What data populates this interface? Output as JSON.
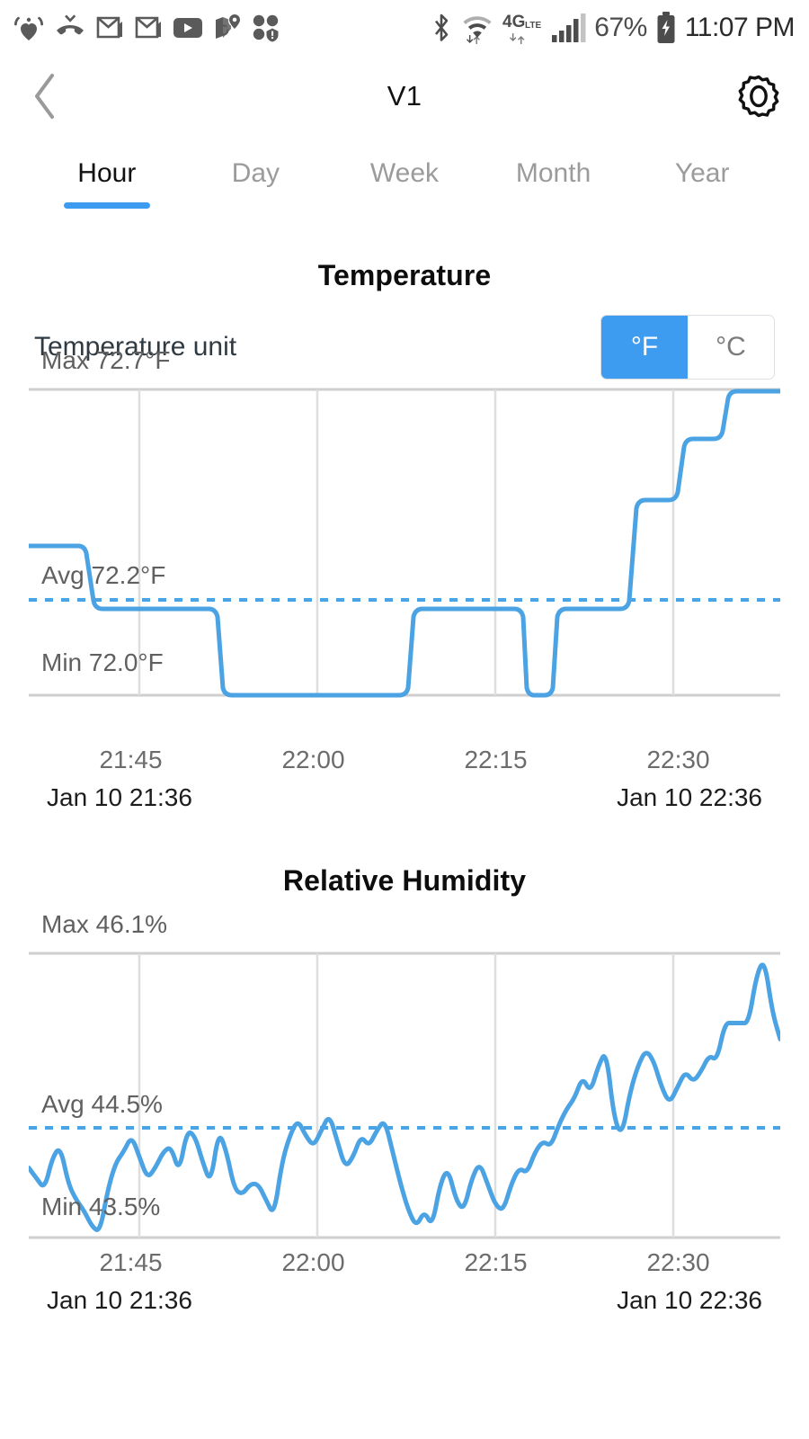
{
  "status_bar": {
    "left_icons": [
      "iheartradio-icon",
      "missed-call-icon",
      "gmail-icon",
      "gmail-icon",
      "youtube-icon",
      "google-maps-icon",
      "app-grid-alert-icon"
    ],
    "right_icons": [
      "bluetooth-icon",
      "wifi-icon",
      "4g-lte-icon",
      "signal-bars-icon",
      "battery-charging-icon"
    ],
    "battery_percent": "67%",
    "clock": "11:07 PM"
  },
  "header": {
    "back_label": "‹",
    "title": "V1",
    "settings_icon": "gear-icon"
  },
  "tabs": [
    {
      "label": "Hour",
      "active": true
    },
    {
      "label": "Day",
      "active": false
    },
    {
      "label": "Week",
      "active": false
    },
    {
      "label": "Month",
      "active": false
    },
    {
      "label": "Year",
      "active": false
    }
  ],
  "temperature": {
    "title": "Temperature",
    "unit_label": "Temperature unit",
    "unit_options": [
      "°F",
      "°C"
    ],
    "unit_selected": "°F",
    "max_label": "Max 72.7°F",
    "avg_label": "Avg 72.2°F",
    "min_label": "Min 72.0°F",
    "x_ticks": [
      "21:45",
      "22:00",
      "22:15",
      "22:30"
    ],
    "range_start": "Jan 10 21:36",
    "range_end": "Jan 10 22:36"
  },
  "humidity": {
    "title": "Relative Humidity",
    "max_label": "Max 46.1%",
    "avg_label": "Avg 44.5%",
    "min_label": "Min 43.5%",
    "x_ticks": [
      "21:45",
      "22:00",
      "22:15",
      "22:30"
    ],
    "range_start": "Jan 10 21:36",
    "range_end": "Jan 10 22:36"
  },
  "colors": {
    "accent": "#3d9bf0",
    "line": "#4ba3e3",
    "grid": "#d8d8d8",
    "muted_text": "#9b9b9b"
  },
  "chart_data": [
    {
      "id": "temperature-chart",
      "type": "line",
      "title": "Temperature",
      "xlabel": "",
      "ylabel": "°F",
      "ylim": [
        72.0,
        72.7
      ],
      "xlim": [
        "21:36",
        "22:36"
      ],
      "x_tick_labels": [
        "21:45",
        "22:00",
        "22:15",
        "22:30"
      ],
      "grid": true,
      "max": 72.7,
      "avg": 72.2,
      "min": 72.0,
      "avg_line": 72.2,
      "unit": "°F",
      "series": [
        {
          "name": "Temperature",
          "step": true,
          "points": [
            {
              "t": "21:36",
              "v": 72.3
            },
            {
              "t": "21:39",
              "v": 72.3
            },
            {
              "t": "21:40",
              "v": 72.2
            },
            {
              "t": "21:50",
              "v": 72.2
            },
            {
              "t": "21:51",
              "v": 72.0
            },
            {
              "t": "22:06",
              "v": 72.0
            },
            {
              "t": "22:07",
              "v": 72.2
            },
            {
              "t": "22:14",
              "v": 72.2
            },
            {
              "t": "22:15",
              "v": 72.0
            },
            {
              "t": "22:16",
              "v": 72.2
            },
            {
              "t": "22:25",
              "v": 72.2
            },
            {
              "t": "22:26",
              "v": 72.4
            },
            {
              "t": "22:28",
              "v": 72.4
            },
            {
              "t": "22:29",
              "v": 72.55
            },
            {
              "t": "22:33",
              "v": 72.55
            },
            {
              "t": "22:34",
              "v": 72.7
            },
            {
              "t": "22:36",
              "v": 72.7
            }
          ]
        }
      ]
    },
    {
      "id": "humidity-chart",
      "type": "line",
      "title": "Relative Humidity",
      "xlabel": "",
      "ylabel": "%",
      "ylim": [
        43.5,
        46.1
      ],
      "xlim": [
        "21:36",
        "22:36"
      ],
      "x_tick_labels": [
        "21:45",
        "22:00",
        "22:15",
        "22:30"
      ],
      "grid": true,
      "max": 46.1,
      "avg": 44.5,
      "min": 43.5,
      "avg_line": 44.5,
      "unit": "%",
      "series": [
        {
          "name": "Relative Humidity",
          "step": false,
          "values": [
            44.15,
            44.05,
            43.95,
            44.25,
            44.35,
            44.0,
            43.85,
            43.75,
            43.6,
            43.55,
            43.95,
            44.2,
            44.3,
            44.45,
            44.25,
            44.05,
            44.15,
            44.3,
            44.35,
            44.1,
            44.5,
            44.45,
            44.2,
            44.0,
            44.5,
            44.3,
            43.95,
            43.9,
            44.0,
            44.0,
            43.85,
            43.7,
            44.2,
            44.45,
            44.6,
            44.45,
            44.35,
            44.5,
            44.65,
            44.4,
            44.15,
            44.25,
            44.45,
            44.35,
            44.5,
            44.6,
            44.3,
            44.0,
            43.75,
            43.6,
            43.75,
            43.6,
            44.0,
            44.15,
            43.85,
            43.75,
            44.05,
            44.2,
            44.0,
            43.8,
            43.75,
            44.0,
            44.15,
            44.1,
            44.3,
            44.4,
            44.35,
            44.55,
            44.7,
            44.8,
            45.0,
            44.85,
            45.1,
            45.25,
            44.6,
            44.45,
            44.85,
            45.1,
            45.25,
            45.15,
            44.9,
            44.75,
            44.9,
            45.05,
            44.95,
            45.05,
            45.2,
            45.15,
            45.5,
            45.5,
            45.5,
            45.5,
            45.95,
            46.1,
            45.6,
            45.35
          ]
        }
      ]
    }
  ]
}
